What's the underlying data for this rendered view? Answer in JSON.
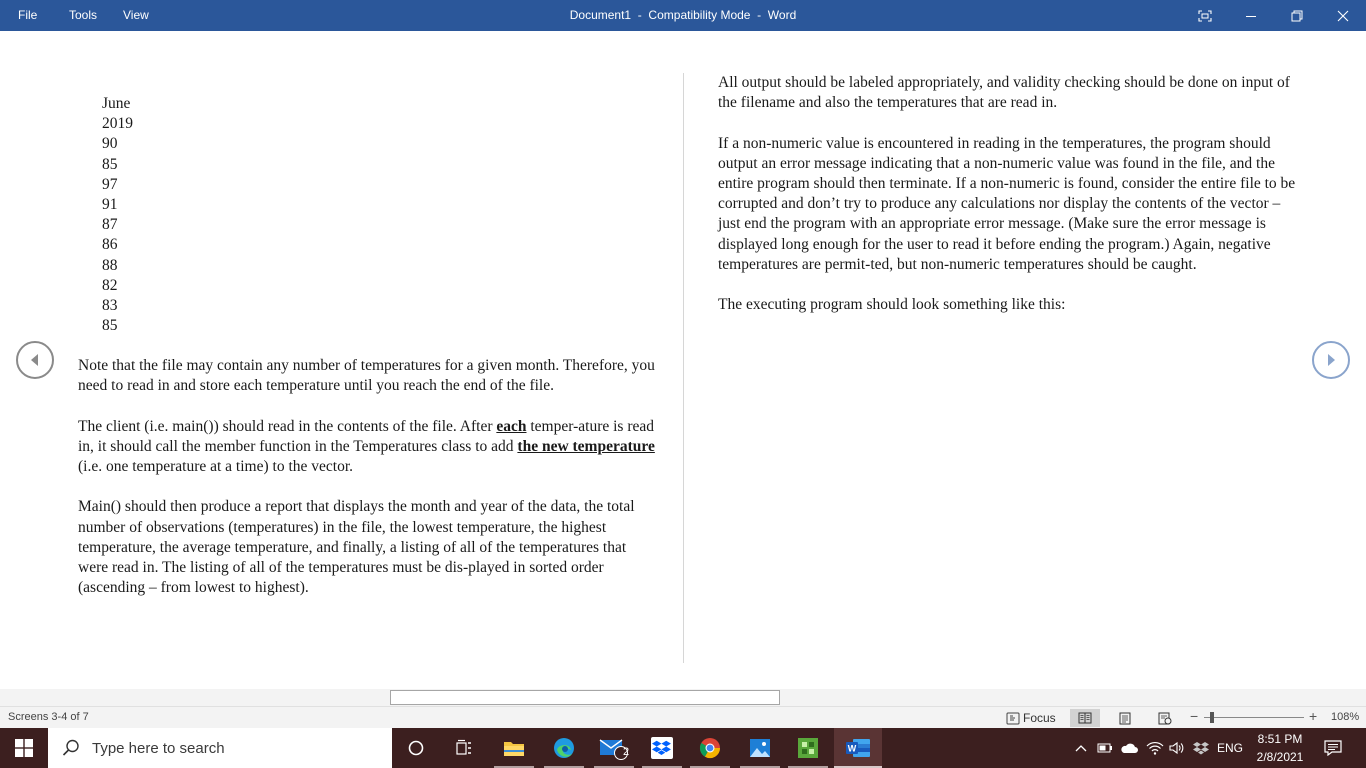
{
  "titlebar": {
    "menu": [
      "File",
      "Tools",
      "View"
    ],
    "document_title": "Document1  -  Compatibility Mode  -  Word",
    "bg_color": "#2b579a"
  },
  "document": {
    "data_list": [
      "June",
      "2019",
      "90",
      "85",
      "97",
      "91",
      "87",
      "86",
      "88",
      "82",
      "83",
      "85"
    ],
    "left": {
      "p1": "Note that the file may contain any number of temperatures for a given month. Therefore, you need to read in and store each temperature until you reach the end of the file.",
      "p2_a": "The client (i.e. main()) should read in the contents of the file.  After ",
      "p2_b": "each",
      "p2_c": " temper-ature is read in, it should call the member function in the Temperatures class to add ",
      "p2_d": "the new temperature",
      "p2_e": " (i.e. one temperature at a time) to the vector.",
      "p3": "Main() should then produce a report that displays the month and year of the data, the total number of observations (temperatures) in the file, the lowest temperature, the highest temperature, the average temperature, and finally, a listing of all of the temperatures that were read in.  The listing of all of the temperatures must be dis-played in sorted order (ascending – from lowest to highest)."
    },
    "right": {
      "p1": "All output should be labeled appropriately, and validity checking should be done on input of the filename and also the temperatures that are read in.",
      "p2": "If a non-numeric value is encountered in reading in the temperatures, the program should output an error message indicating that a non-numeric value was found in the file, and the entire program should then terminate.  If a non-numeric is found, consider the entire file to be corrupted and don’t try to produce any calculations nor display the contents of the vector – just end the program with an appropriate error message. (Make sure the error message is displayed long enough for the user to read it before ending the program.)  Again, negative temperatures are permit-ted, but non-numeric temperatures should be caught.",
      "p3": "The executing program should look something like this:"
    }
  },
  "statusbar": {
    "pages": "Screens 3-4 of 7",
    "focus_label": "Focus",
    "zoom_minus": "−",
    "zoom_plus": "+",
    "zoom_level": "108%",
    "zoom_fraction": 0.08
  },
  "taskbar": {
    "search_placeholder": "Type here to search",
    "mail_badge": "2",
    "language": "ENG",
    "time": "8:51 PM",
    "date": "2/8/2021",
    "bg_color": "#3c1f1f"
  }
}
